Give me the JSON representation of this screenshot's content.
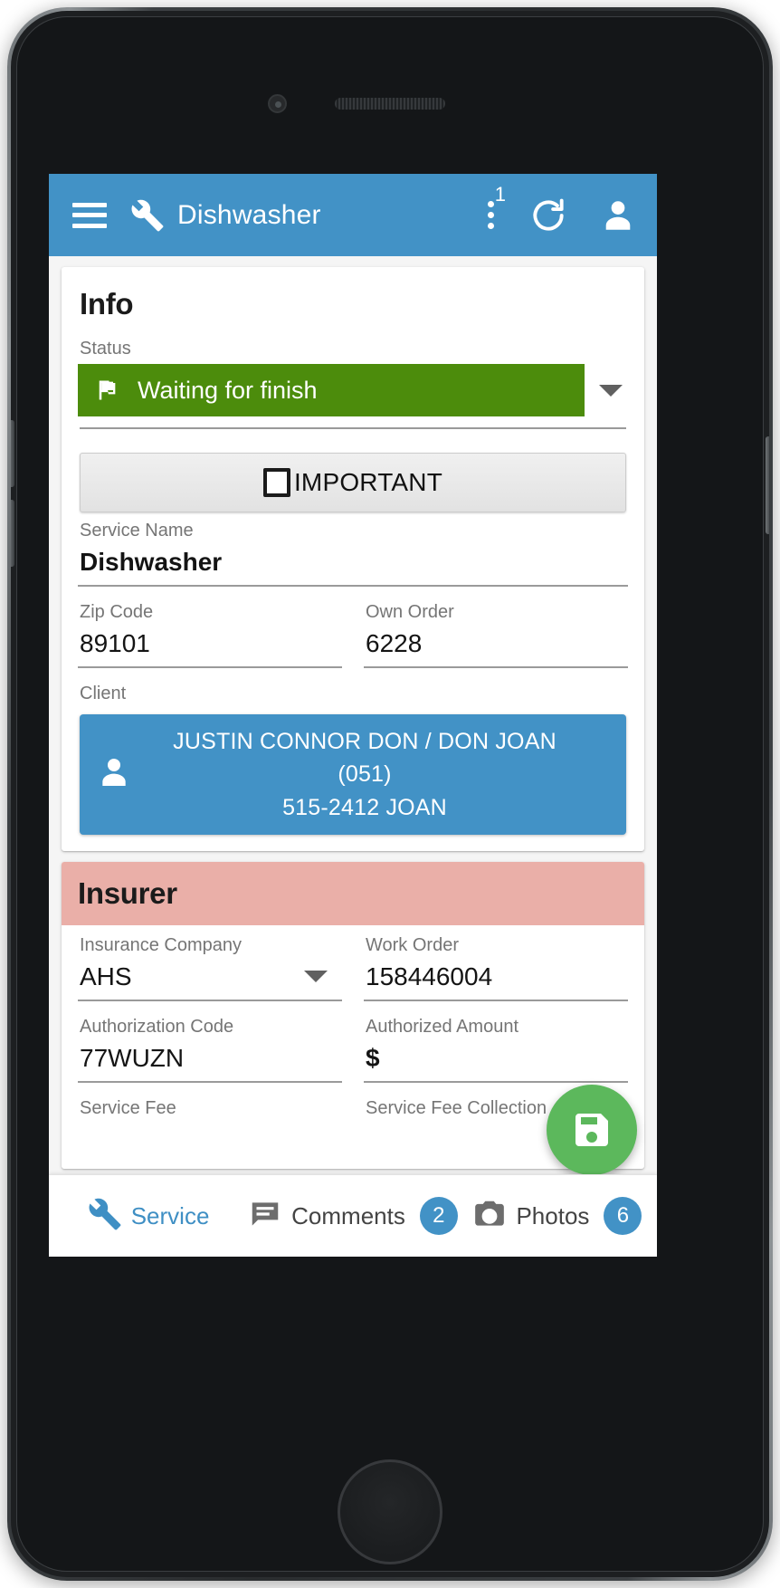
{
  "appbar": {
    "title": "Dishwasher",
    "menu_icon": "hamburger-menu-icon",
    "wrench_icon": "wrench-icon",
    "overflow_icon": "overflow-menu-icon",
    "overflow_badge": "1",
    "refresh_icon": "refresh-icon",
    "profile_icon": "person-icon",
    "background_color": "#4292c6"
  },
  "info_card": {
    "title": "Info",
    "status": {
      "label": "Status",
      "value": "Waiting for finish",
      "icon": "flag-icon",
      "color": "#4c8c0c",
      "caret_icon": "chevron-down-icon"
    },
    "important": {
      "label": "IMPORTANT",
      "checked": false,
      "icon": "checkbox-unchecked-icon"
    },
    "service_name": {
      "label": "Service Name",
      "value": "Dishwasher"
    },
    "zip_code": {
      "label": "Zip Code",
      "value": "89101"
    },
    "own_order": {
      "label": "Own Order",
      "value": "6228"
    },
    "client": {
      "label": "Client",
      "icon": "person-icon",
      "line1": "JUSTIN CONNOR DON / DON JOAN (051)",
      "line2": "515-2412 JOAN",
      "color": "#4292c6"
    }
  },
  "insurer_card": {
    "title": "Insurer",
    "header_color": "#eaafa8",
    "insurance_company": {
      "label": "Insurance Company",
      "value": "AHS",
      "caret_icon": "chevron-down-icon"
    },
    "work_order": {
      "label": "Work Order",
      "value": "158446004"
    },
    "authorization_code": {
      "label": "Authorization Code",
      "value": "77WUZN"
    },
    "authorized_amount": {
      "label": "Authorized Amount",
      "value": "$"
    },
    "service_fee": {
      "label": "Service Fee",
      "value": ""
    },
    "service_fee_collection": {
      "label": "Service Fee Collection",
      "value": ""
    }
  },
  "fab": {
    "icon": "save-icon",
    "color": "#5cb85c"
  },
  "bottom_nav": {
    "items": [
      {
        "label": "Service",
        "icon": "wrench-icon",
        "badge": "",
        "active": true
      },
      {
        "label": "Comments",
        "icon": "comment-icon",
        "badge": "2",
        "active": false
      },
      {
        "label": "Photos",
        "icon": "camera-icon",
        "badge": "6",
        "active": false
      }
    ]
  }
}
